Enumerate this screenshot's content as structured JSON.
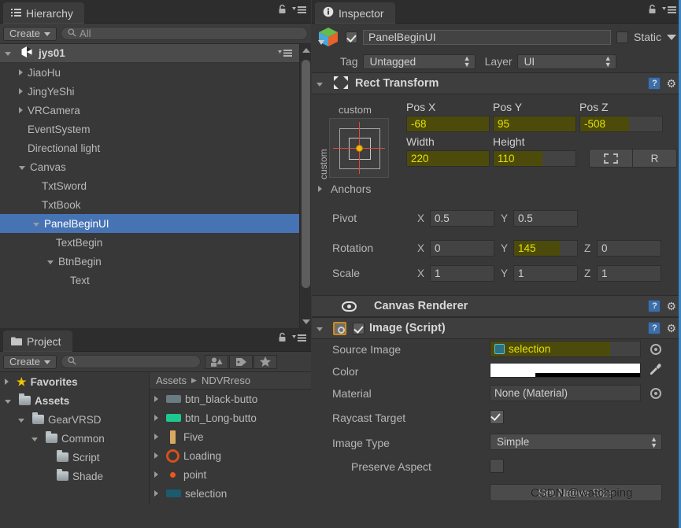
{
  "hierarchy": {
    "tab_label": "Hierarchy",
    "tab_icon": "hierarchy-icon",
    "lock_icon": "lock-icon",
    "menu_icon": "hamburger-menu-icon",
    "create_label": "Create",
    "search_placeholder": "All",
    "search_value": "All",
    "scene_name": "jys01",
    "items": [
      {
        "label": "JiaoHu",
        "indent": 1,
        "expander": "collapsed",
        "selected": false
      },
      {
        "label": "JingYeShi",
        "indent": 1,
        "expander": "collapsed",
        "selected": false
      },
      {
        "label": "VRCamera",
        "indent": 1,
        "expander": "collapsed",
        "selected": false
      },
      {
        "label": "EventSystem",
        "indent": 1,
        "expander": "none",
        "selected": false
      },
      {
        "label": "Directional light",
        "indent": 1,
        "expander": "none",
        "selected": false
      },
      {
        "label": "Canvas",
        "indent": 1,
        "expander": "expanded",
        "selected": false
      },
      {
        "label": "TxtSword",
        "indent": 2,
        "expander": "none",
        "selected": false
      },
      {
        "label": "TxtBook",
        "indent": 2,
        "expander": "none",
        "selected": false
      },
      {
        "label": "PanelBeginUI",
        "indent": 2,
        "expander": "expanded",
        "selected": true
      },
      {
        "label": "TextBegin",
        "indent": 3,
        "expander": "none",
        "selected": false
      },
      {
        "label": "BtnBegin",
        "indent": 3,
        "expander": "expanded",
        "selected": false
      },
      {
        "label": "Text",
        "indent": 4,
        "expander": "none",
        "selected": false
      }
    ]
  },
  "project": {
    "tab_label": "Project",
    "tab_icon": "folder-icon",
    "lock_icon": "lock-icon",
    "menu_icon": "hamburger-menu-icon",
    "create_label": "Create",
    "search_placeholder": "",
    "filters": [
      {
        "name": "type-filter-icon",
        "glyph": "◔"
      },
      {
        "name": "label-filter-icon",
        "glyph": "Ἷ7"
      },
      {
        "name": "favorite-filter-icon",
        "glyph": "★"
      }
    ],
    "favorites_label": "Favorites",
    "folders": [
      {
        "label": "Assets",
        "indent": 0,
        "expander": "expanded",
        "bold": true
      },
      {
        "label": "GearVRSD",
        "indent": 1,
        "expander": "expanded",
        "bold": false
      },
      {
        "label": "Common",
        "indent": 2,
        "expander": "expanded",
        "bold": false
      },
      {
        "label": "Script",
        "indent": 3,
        "expander": "none",
        "bold": false
      },
      {
        "label": "Shade",
        "indent": 3,
        "expander": "none",
        "bold": false
      }
    ],
    "breadcrumb": [
      "Assets",
      "NDVRreso"
    ],
    "assets": [
      {
        "label": "btn_black-butto",
        "color": "#6a7b82"
      },
      {
        "label": "btn_Long-butto",
        "color": "#1ec98f"
      },
      {
        "label": "Five",
        "color": "#d8a860",
        "shape": "bar"
      },
      {
        "label": "Loading",
        "color": "#d2521a",
        "shape": "ring"
      },
      {
        "label": "point",
        "color": "#e8591a",
        "shape": "dot"
      },
      {
        "label": "selection",
        "color": "#1c5a6e"
      }
    ]
  },
  "inspector": {
    "tab_label": "Inspector",
    "tab_icon": "info-icon",
    "lock_icon": "lock-icon",
    "menu_icon": "hamburger-menu-icon",
    "object_icon": "gameobject-cube-icon",
    "object_enabled": true,
    "object_name": "PanelBeginUI",
    "static_label": "Static",
    "static_checked": false,
    "tag_label": "Tag",
    "tag_value": "Untagged",
    "layer_label": "Layer",
    "layer_value": "UI",
    "rect_transform": {
      "title": "Rect Transform",
      "icon": "rect-transform-icon",
      "help_icon": "help-book-icon",
      "gear_icon": "gear-icon",
      "anchor_preset_label": "custom",
      "anchor_preset_vertical_label": "custom",
      "pos_x_label": "Pos X",
      "pos_x_value": "-68",
      "pos_x_animated": true,
      "pos_y_label": "Pos Y",
      "pos_y_value": "95",
      "pos_y_animated": true,
      "pos_z_label": "Pos Z",
      "pos_z_value": "-508",
      "pos_z_animated": true,
      "width_label": "Width",
      "width_value": "220",
      "width_animated": true,
      "height_label": "Height",
      "height_value": "110",
      "height_animated": true,
      "blueprint_button": "blueprint-mode-icon",
      "raw_button_label": "R",
      "anchors_label": "Anchors",
      "pivot_label": "Pivot",
      "pivot_x_axis": "X",
      "pivot_x_value": "0.5",
      "pivot_y_axis": "Y",
      "pivot_y_value": "0.5",
      "rotation_label": "Rotation",
      "rot_x_axis": "X",
      "rot_x_value": "0",
      "rot_y_axis": "Y",
      "rot_y_value": "145",
      "rot_y_animated": true,
      "rot_z_axis": "Z",
      "rot_z_value": "0",
      "scale_label": "Scale",
      "scale_x_axis": "X",
      "scale_x_value": "1",
      "scale_y_axis": "Y",
      "scale_y_value": "1",
      "scale_z_axis": "Z",
      "scale_z_value": "1"
    },
    "canvas_renderer": {
      "title": "Canvas Renderer",
      "icon": "eye-icon",
      "help_icon": "help-book-icon",
      "gear_icon": "gear-icon"
    },
    "image_script": {
      "title": "Image (Script)",
      "icon": "image-script-icon",
      "enabled": true,
      "help_icon": "help-book-icon",
      "gear_icon": "gear-icon",
      "source_image_label": "Source Image",
      "source_image_value": "selection",
      "source_image_animated": true,
      "color_label": "Color",
      "color_value": "#FFFFFF",
      "color_picker_icon": "eyedropper-icon",
      "material_label": "Material",
      "material_value": "None (Material)",
      "raycast_label": "Raycast Target",
      "raycast_checked": true,
      "image_type_label": "Image Type",
      "image_type_value": "Simple",
      "preserve_aspect_label": "Preserve Aspect",
      "preserve_aspect_checked": false,
      "set_native_size_label": "Set Native Size"
    }
  },
  "watermark": "CSDN @watchping",
  "colors": {
    "selection_blue": "#4673b4",
    "animated_bg": "#4d4b0c",
    "animated_text": "#e2e200",
    "panel_bg": "#383838"
  }
}
